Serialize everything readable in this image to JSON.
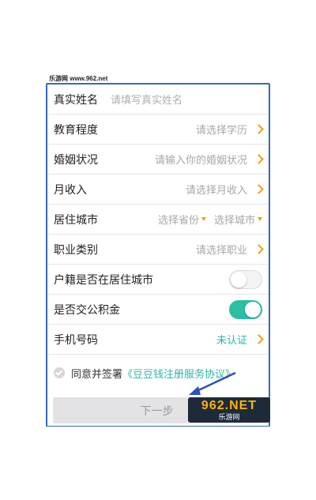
{
  "watermark": "乐游网 www.962.net",
  "form": {
    "rows": [
      {
        "label": "真实姓名",
        "placeholder": "请填写真实姓名"
      },
      {
        "label": "教育程度",
        "placeholder": "请选择学历"
      },
      {
        "label": "婚姻状况",
        "placeholder": "请输入你的婚姻状况"
      },
      {
        "label": "月收入",
        "placeholder": "请选择月收入"
      },
      {
        "label": "居住城市",
        "province": "选择省份",
        "city": "选择城市"
      },
      {
        "label": "职业类别",
        "placeholder": "请选择职业"
      },
      {
        "label": "户籍是否在居住城市",
        "toggle": false
      },
      {
        "label": "是否交公积金",
        "toggle": true
      },
      {
        "label": "手机号码",
        "status": "未认证"
      }
    ]
  },
  "agreement": {
    "text": "同意并签署",
    "link": "《豆豆钱注册服务协议》"
  },
  "next_button": "下一步",
  "logo": {
    "main": "962.NET",
    "sub": "乐游网"
  },
  "colors": {
    "accent": "#29b6a8",
    "chevron": "#e8a317",
    "highlight_border": "#3a66c4"
  }
}
